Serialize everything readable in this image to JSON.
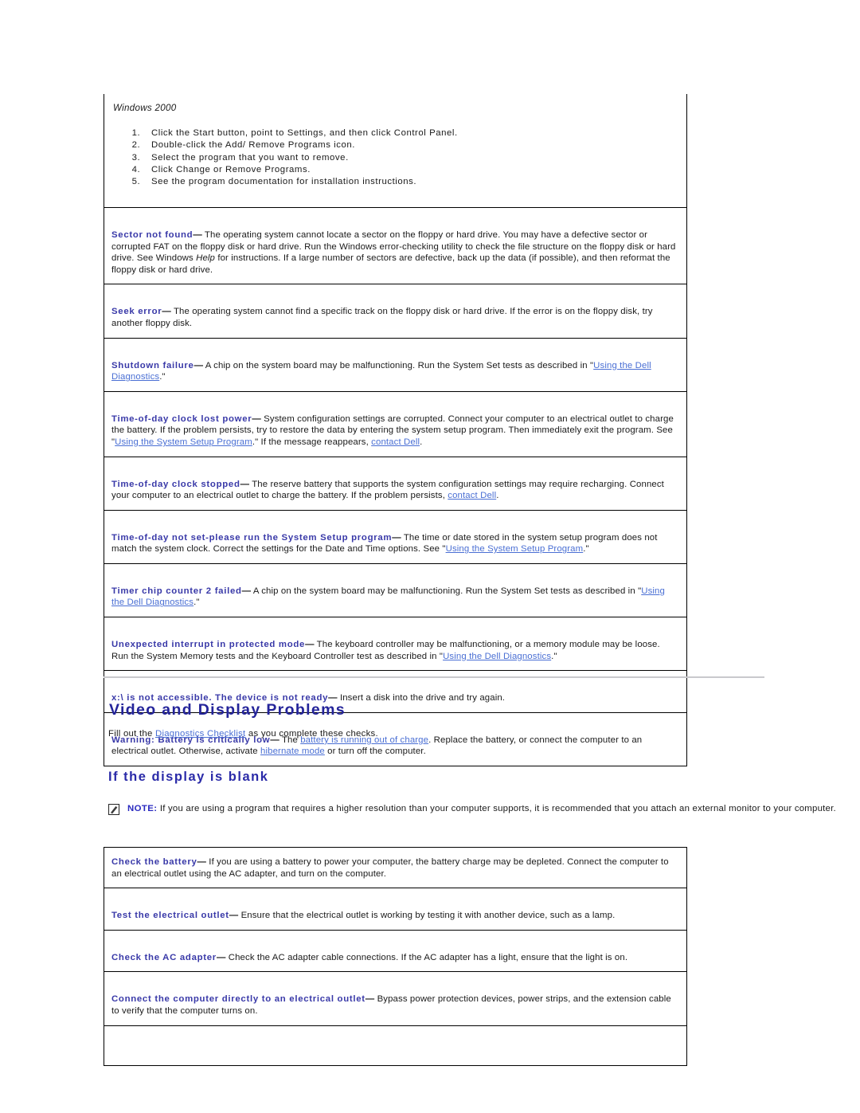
{
  "colors": {
    "term_blue": "#3939a8",
    "link_blue": "#4a6fd4",
    "heading_blue": "#24249a",
    "subheading_blue": "#2a2aa8",
    "note_label_blue": "#2a2ac0",
    "rule_gray": "#c9c9cd",
    "table_border": "#000000"
  },
  "messages_table": {
    "windows_block": {
      "os_label": "Windows 2000",
      "steps": [
        "Click the Start button, point to Settings, and then click Control Panel.",
        "Double-click the Add/ Remove Programs icon.",
        "Select the program that you want to remove.",
        "Click Change or Remove Programs.",
        "See the program documentation for installation instructions."
      ]
    },
    "rows": [
      {
        "term": "Sector not found",
        "dash": "—",
        "text_1": " The operating system cannot locate a sector on the floppy or hard drive. You may have a defective sector or corrupted FAT on the floppy disk or hard drive. Run the Windows error-checking utility to check the file structure on the floppy disk or hard drive. See Windows ",
        "italic_1": "Help",
        "text_2": " for instructions. If a large number of sectors are defective, back up the data (if possible), and then reformat the floppy disk or hard drive."
      },
      {
        "term": "Seek error",
        "dash": "—",
        "text_1": " The operating system cannot find a specific track on the floppy disk or hard drive. If the error is on the floppy disk, try another floppy disk."
      },
      {
        "term": "Shutdown failure",
        "dash": "—",
        "text_1": " A chip on the system board may be malfunctioning. Run the System Set tests as described in \"",
        "link_1": "Using the Dell Diagnostics",
        "text_2": ".\""
      },
      {
        "term": "Time-of-day clock lost power",
        "dash": "—",
        "text_1": " System configuration settings are corrupted. Connect your computer to an electrical outlet to charge the battery. If the problem persists, try to restore the data by entering the system setup program. Then immediately exit the program. See \"",
        "link_1": "Using the System Setup Program",
        "text_2": ".\" If the message reappears, ",
        "link_2": "contact Dell",
        "text_3": "."
      },
      {
        "term": "Time-of-day clock stopped",
        "dash": "—",
        "text_1": " The reserve battery that supports the system configuration settings may require recharging. Connect your computer to an electrical outlet to charge the battery. If the problem persists, ",
        "link_1": "contact Dell",
        "text_2": "."
      },
      {
        "term": "Time-of-day not set-please run the System Setup program",
        "dash": "—",
        "text_1": " The time or date stored in the system setup program does not match the system clock. Correct the settings for the Date and Time options. See \"",
        "link_1": "Using the System Setup Program",
        "text_2": ".\""
      },
      {
        "term": "Timer chip counter 2 failed",
        "dash": "—",
        "text_1": " A chip on the system board may be malfunctioning. Run the System Set tests as described in \"",
        "link_1": "Using the Dell Diagnostics",
        "text_2": ".\""
      },
      {
        "term": "Unexpected interrupt in protected mode",
        "dash": "—",
        "text_1": " The keyboard controller may be malfunctioning, or a memory module may be loose. Run the System Memory tests and the Keyboard Controller test as described in \"",
        "link_1": "Using the Dell Diagnostics",
        "text_2": ".\""
      },
      {
        "term": "x:\\ is not accessible. The device is not ready",
        "dash": "—",
        "text_1": " Insert a disk into the drive and try again."
      },
      {
        "term": "Warning: Battery is critically low",
        "dash": "—",
        "text_1": " The ",
        "link_1": "battery is running out of charge",
        "text_2": ". Replace the battery, or connect the computer to an electrical outlet. Otherwise, activate ",
        "link_2": "hibernate mode",
        "text_3": " or turn off the computer."
      }
    ]
  },
  "section": {
    "heading": "Video and Display Problems",
    "lead_prefix": "Fill out the ",
    "lead_link": "Diagnostics Checklist",
    "lead_suffix": " as you complete these checks.",
    "subheading": "If the display is blank"
  },
  "note": {
    "icon": "note-pencil-icon",
    "label": "NOTE:",
    "text": " If you are using a program that requires a higher resolution than your computer supports, it is recommended that you attach an external monitor to your computer."
  },
  "display_table": {
    "rows": [
      {
        "term": "Check the battery",
        "dash": "—",
        "text_1": " If you are using a battery to power your computer, the battery charge may be depleted. Connect the computer to an electrical outlet using the AC adapter, and turn on the computer."
      },
      {
        "term": "Test the electrical outlet",
        "dash": "—",
        "text_1": " Ensure that the electrical outlet is working by testing it with another device, such as a lamp."
      },
      {
        "term": "Check the AC adapter",
        "dash": "—",
        "text_1": " Check the AC adapter cable connections. If the AC adapter has a light, ensure that the light is on."
      },
      {
        "term": "Connect the computer directly to an electrical outlet",
        "dash": "—",
        "text_1": " Bypass power protection devices, power strips, and the extension cable to verify that the computer turns on."
      }
    ]
  }
}
